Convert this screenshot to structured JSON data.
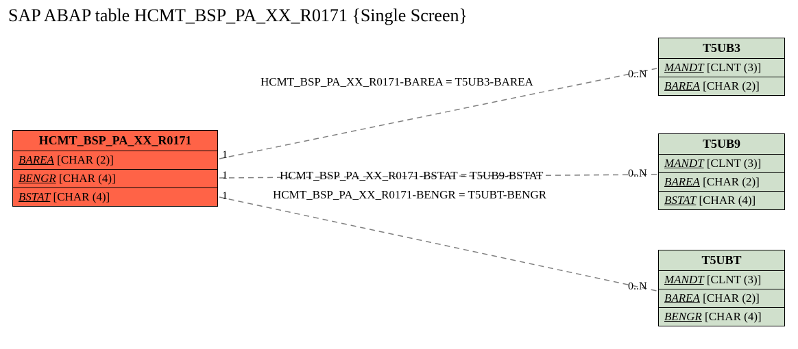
{
  "title": "SAP ABAP table HCMT_BSP_PA_XX_R0171 {Single Screen}",
  "main": {
    "name": "HCMT_BSP_PA_XX_R0171",
    "fields": [
      {
        "name": "BAREA",
        "type": "[CHAR (2)]"
      },
      {
        "name": "BENGR",
        "type": "[CHAR (4)]"
      },
      {
        "name": "BSTAT",
        "type": "[CHAR (4)]"
      }
    ]
  },
  "related": [
    {
      "name": "T5UB3",
      "fields": [
        {
          "name": "MANDT",
          "type": "[CLNT (3)]"
        },
        {
          "name": "BAREA",
          "type": "[CHAR (2)]"
        }
      ]
    },
    {
      "name": "T5UB9",
      "fields": [
        {
          "name": "MANDT",
          "type": "[CLNT (3)]"
        },
        {
          "name": "BAREA",
          "type": "[CHAR (2)]"
        },
        {
          "name": "BSTAT",
          "type": "[CHAR (4)]"
        }
      ]
    },
    {
      "name": "T5UBT",
      "fields": [
        {
          "name": "MANDT",
          "type": "[CLNT (3)]"
        },
        {
          "name": "BAREA",
          "type": "[CHAR (2)]"
        },
        {
          "name": "BENGR",
          "type": "[CHAR (4)]"
        }
      ]
    }
  ],
  "relations": [
    {
      "label": "HCMT_BSP_PA_XX_R0171-BAREA = T5UB3-BAREA",
      "left_card": "1",
      "right_card": "0..N"
    },
    {
      "label": "HCMT_BSP_PA_XX_R0171-BSTAT = T5UB9-BSTAT",
      "left_card": "1",
      "right_card": "0..N"
    },
    {
      "label": "HCMT_BSP_PA_XX_R0171-BENGR = T5UBT-BENGR",
      "left_card": "1",
      "right_card": "0..N"
    }
  ]
}
